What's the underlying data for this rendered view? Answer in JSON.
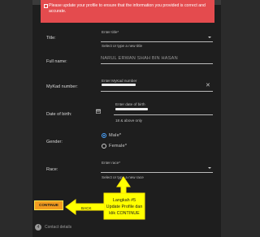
{
  "alert": {
    "text": "Please update your profile to ensure that the information you provided is correct and accurate."
  },
  "form": {
    "title": {
      "label": "Title:",
      "placeholder": "Enter title*",
      "hint": "Select or type a new title"
    },
    "full_name": {
      "label": "Full name:",
      "value": "NARUL ERWAN SHAH BIN HASAN"
    },
    "mykad": {
      "label": "MyKad number:",
      "placeholder": "Enter MyKad number",
      "clear_icon": "close-icon"
    },
    "dob": {
      "label": "Date of birth:",
      "placeholder": "Enter date of birth",
      "hint": "18 & above only",
      "icon": "calendar-icon"
    },
    "gender": {
      "label": "Gender:",
      "options": [
        "Male*",
        "Female*"
      ],
      "selected": "Male*"
    },
    "race": {
      "label": "Race:",
      "placeholder": "Enter race*",
      "hint": "Select or type a new race"
    }
  },
  "actions": {
    "continue_label": "CONTINUE",
    "back_label": "BACK"
  },
  "steps": {
    "number": "4",
    "label": "Contact details"
  },
  "annotation": {
    "lines": [
      "Langkah #5",
      "Update Profile dan",
      "klik CONTINUE"
    ],
    "colors": {
      "fill": "#ffff00",
      "stroke": "#ffe900",
      "text": "#1a1a1a"
    }
  },
  "colors": {
    "alert": "#e44b4e",
    "accent": "#f39c1f",
    "radio": "#4aa3ff",
    "panel": "#1e1e1e",
    "page": "#2b2b2b"
  }
}
